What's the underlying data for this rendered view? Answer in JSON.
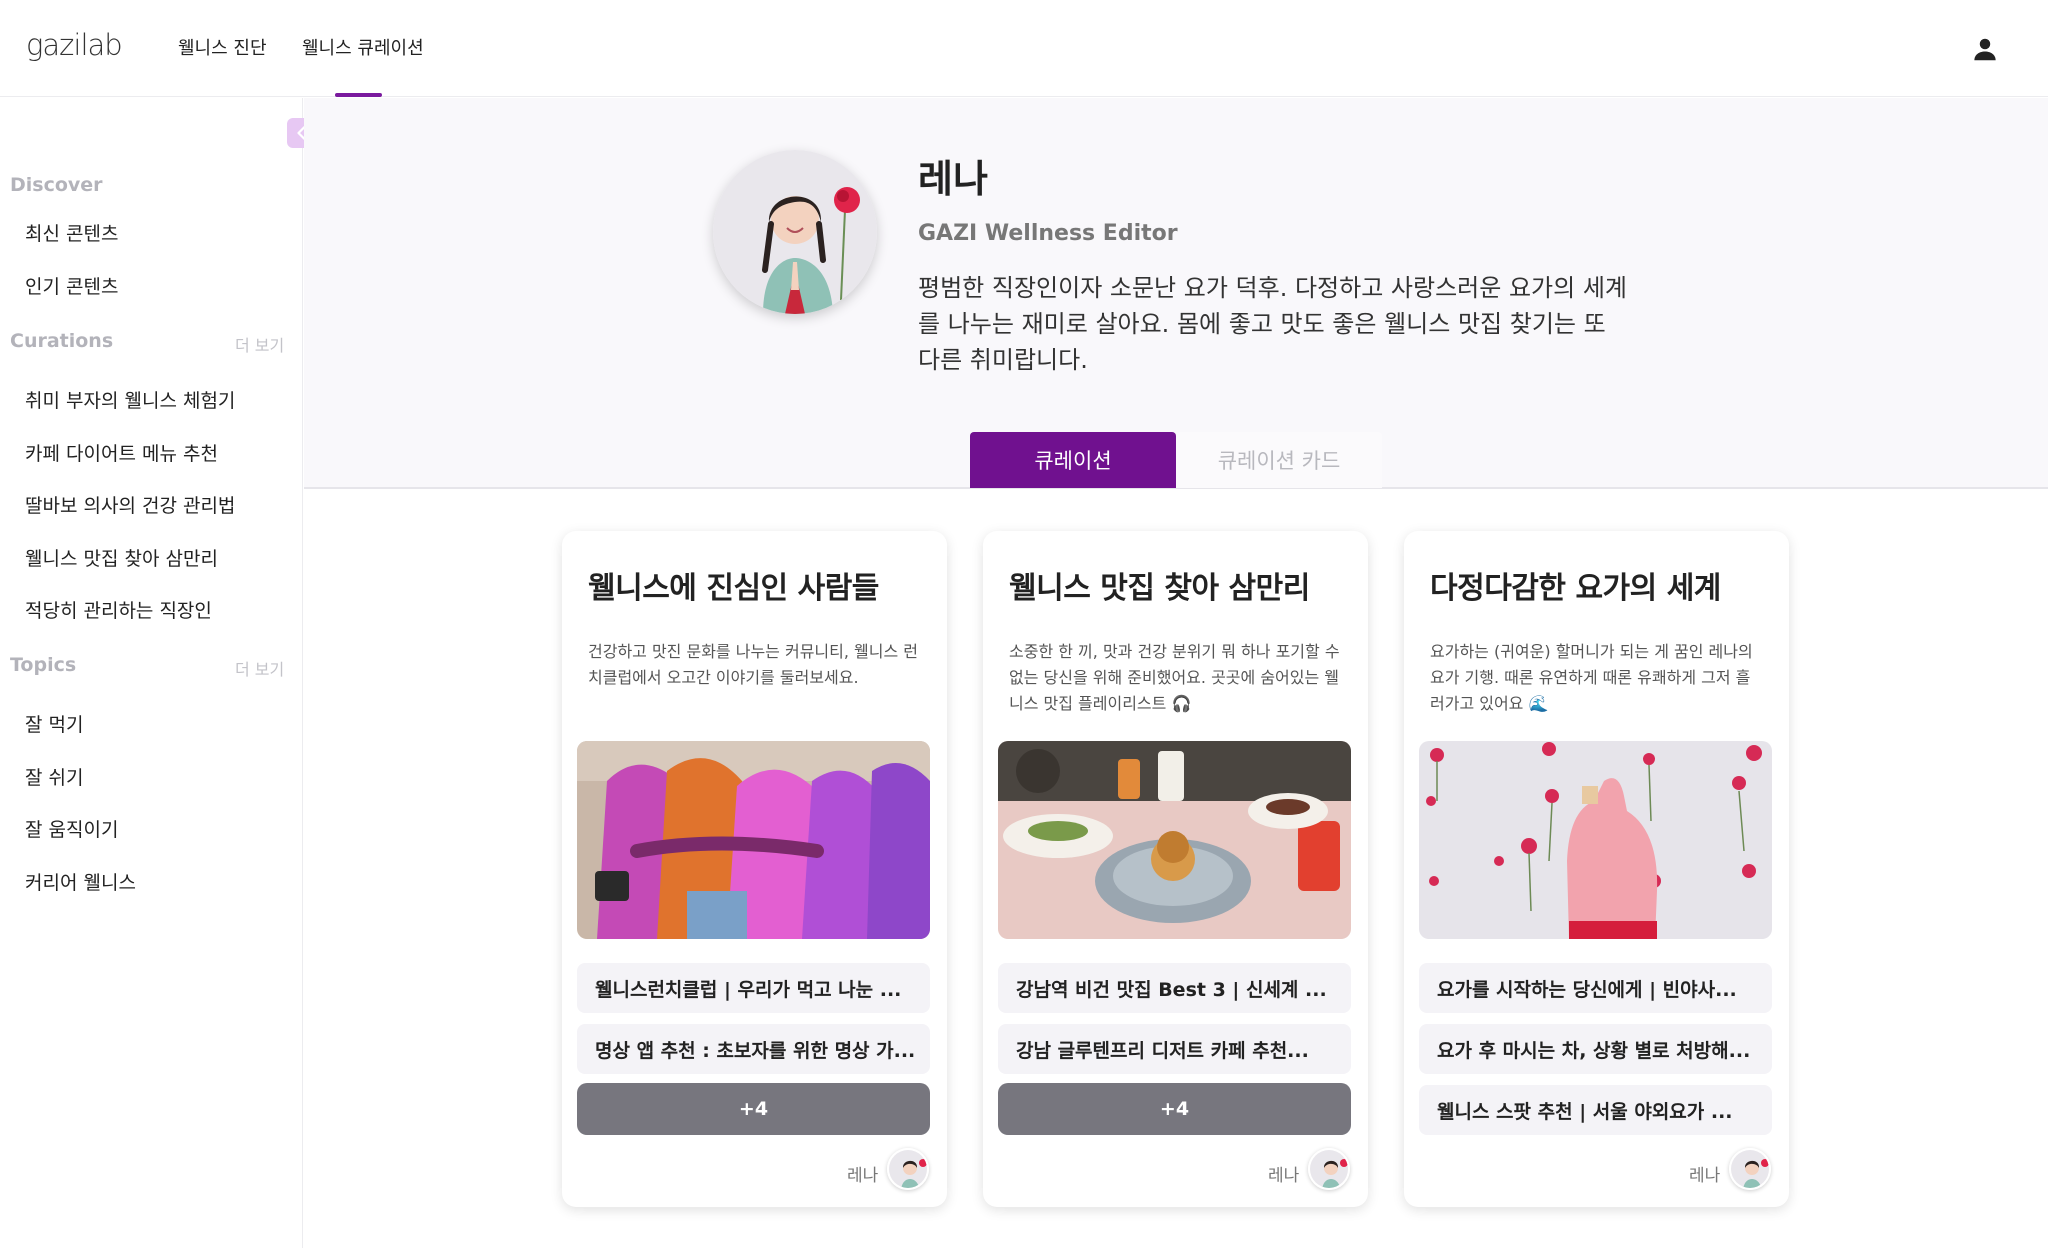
{
  "nav": {
    "logo": "gazilab",
    "links": [
      "웰니스 진단",
      "웰니스 큐레이션"
    ]
  },
  "sidebar": {
    "discover_title": "Discover",
    "discover_items": [
      "최신 콘텐츠",
      "인기 콘텐츠"
    ],
    "curations_title": "Curations",
    "curations_more": "더 보기",
    "curation_items": [
      "취미 부자의 웰니스 체험기",
      "카페 다이어트 메뉴 추천",
      "딸바보 의사의 건강 관리법",
      "웰니스 맛집 찾아 삼만리",
      "적당히 관리하는 직장인"
    ],
    "topics_title": "Topics",
    "topics_more": "더 보기",
    "topic_items": [
      "잘 먹기",
      "잘 쉬기",
      "잘 움직이기",
      "커리어 웰니스"
    ]
  },
  "profile": {
    "name": "레나",
    "role": "GAZI Wellness Editor",
    "bio": "평범한 직장인이자 소문난 요가 덕후. 다정하고 사랑스러운 요가의 세계를 나누는 재미로 살아요. 몸에 좋고 맛도 좋은 웰니스 맛집 찾기는 또 다른 취미랍니다."
  },
  "tabs": {
    "active": "큐레이션",
    "inactive": "큐레이션 카드"
  },
  "cards": [
    {
      "title": "웰니스에 진심인 사람들",
      "desc": "건강하고 맛진 문화를 나누는 커뮤니티, 웰니스 런치클럽에서 오고간 이야기를 둘러보세요.",
      "links": [
        "웰니스런치클럽 | 우리가 먹고 나눈 ...",
        "명상 앱 추천 : 초보자를 위한 명상 가..."
      ],
      "more": "+4",
      "author": "레나"
    },
    {
      "title": "웰니스 맛집 찾아 삼만리",
      "desc": "소중한 한 끼, 맛과 건강 분위기 뭐 하나 포기할 수 없는 당신을 위해 준비했어요. 곳곳에 숨어있는 웰니스 맛집 플레이리스트 🎧",
      "links": [
        "강남역 비건 맛집 Best 3 | 신세계 ...",
        "강남 글루텐프리 디저트 카페 추천..."
      ],
      "more": "+4",
      "author": "레나"
    },
    {
      "title": "다정다감한 요가의 세계",
      "desc": "요가하는 (귀여운) 할머니가 되는 게 꿈인 레나의 요가 기행. 때론 유연하게 때론 유쾌하게 그저 흘러가고 있어요 🌊",
      "links": [
        "요가를 시작하는 당신에게 | 빈야사...",
        "요가 후 마시는 차, 상황 별로 처방해...",
        "웰니스 스팟 추천 | 서울 야외요가 ..."
      ],
      "author": "레나"
    }
  ],
  "colors": {
    "accent": "#70118f",
    "more_button": "#77767e",
    "link_bg": "#f4f3f7"
  },
  "icons": {
    "user": "user-icon",
    "collapse": "chevron-left-icon"
  }
}
